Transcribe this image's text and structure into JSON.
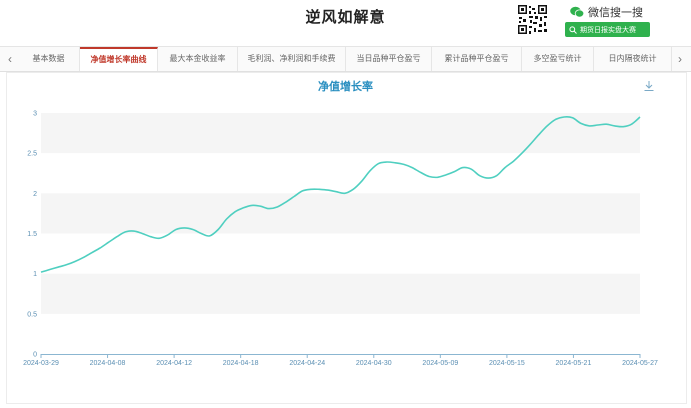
{
  "header": {
    "title": "逆风如解意",
    "wechat_label": "微信搜一搜",
    "search_button_label": "期货日报实盘大赛"
  },
  "tabs": [
    {
      "label": "基本数据",
      "active": false
    },
    {
      "label": "净值增长率曲线",
      "active": true
    },
    {
      "label": "最大本金收益率",
      "active": false
    },
    {
      "label": "毛利润、净利润和手续费",
      "active": false
    },
    {
      "label": "当日品种平仓盈亏",
      "active": false
    },
    {
      "label": "累计品种平仓盈亏",
      "active": false
    },
    {
      "label": "多空盈亏统计",
      "active": false
    },
    {
      "label": "日内隔夜统计",
      "active": false
    }
  ],
  "colors": {
    "accent": "#c0392b",
    "line": "#4fcfc0",
    "title": "#2a8fc0",
    "green": "#2fb14d"
  },
  "chart_data": {
    "type": "line",
    "title": "净值增长率",
    "x_tick_labels": [
      "2024-03-29",
      "2024-04-08",
      "2024-04-12",
      "2024-04-18",
      "2024-04-24",
      "2024-04-30",
      "2024-05-09",
      "2024-05-15",
      "2024-05-21",
      "2024-05-27"
    ],
    "y_tick_labels": [
      "0",
      "0.5",
      "1",
      "1.5",
      "2",
      "2.5",
      "3"
    ],
    "ylim": [
      0,
      3
    ],
    "grid": "alternating horizontal bands",
    "series": [
      {
        "values": [
          1.02,
          1.05,
          1.08,
          1.11,
          1.15,
          1.2,
          1.26,
          1.32,
          1.39,
          1.46,
          1.52,
          1.53,
          1.5,
          1.46,
          1.44,
          1.48,
          1.55,
          1.57,
          1.55,
          1.5,
          1.47,
          1.55,
          1.68,
          1.77,
          1.82,
          1.85,
          1.84,
          1.81,
          1.83,
          1.89,
          1.96,
          2.03,
          2.05,
          2.05,
          2.04,
          2.02,
          2.0,
          2.05,
          2.15,
          2.28,
          2.37,
          2.39,
          2.38,
          2.36,
          2.32,
          2.26,
          2.21,
          2.2,
          2.23,
          2.27,
          2.32,
          2.3,
          2.22,
          2.19,
          2.22,
          2.32,
          2.4,
          2.5,
          2.61,
          2.73,
          2.84,
          2.92,
          2.95,
          2.94,
          2.87,
          2.84,
          2.85,
          2.86,
          2.84,
          2.83,
          2.86,
          2.95
        ]
      }
    ]
  }
}
